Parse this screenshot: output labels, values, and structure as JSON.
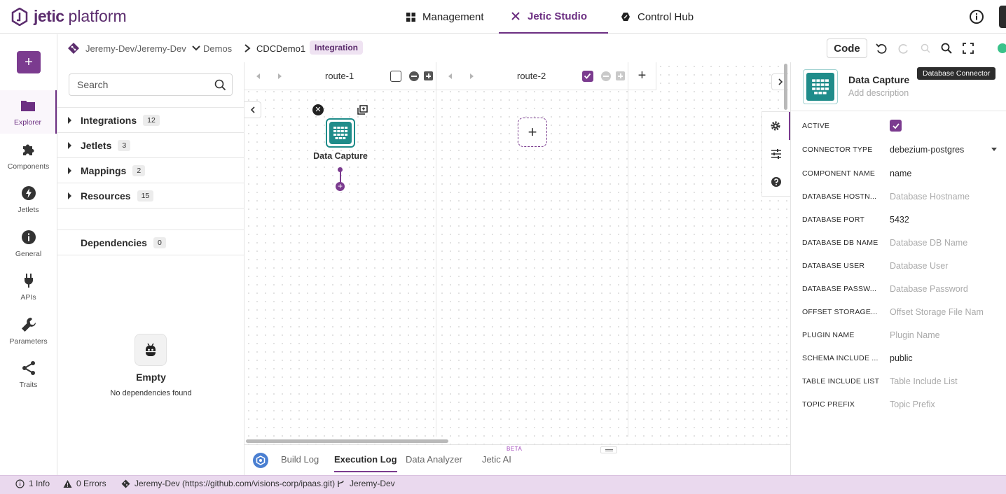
{
  "topbar": {
    "brand_a": "jetic",
    "brand_b": "platform",
    "nav": [
      {
        "label": "Management",
        "icon": "grid-icon"
      },
      {
        "label": "Jetic Studio",
        "icon": "studio-tools-icon",
        "active": true
      },
      {
        "label": "Control Hub",
        "icon": "control-hub-icon"
      }
    ]
  },
  "breadcrumb": {
    "workspace": "Jeremy-Dev/Jeremy-Dev",
    "project": "Demos",
    "item": "CDCDemo1",
    "badge": "Integration"
  },
  "toolbar": {
    "code_label": "Code"
  },
  "rail": {
    "add_label": "+",
    "items": [
      {
        "label": "Explorer",
        "icon": "folder-icon",
        "active": true
      },
      {
        "label": "Components",
        "icon": "puzzle-icon"
      },
      {
        "label": "Jetlets",
        "icon": "bolt-icon"
      },
      {
        "label": "General",
        "icon": "info-icon"
      },
      {
        "label": "APIs",
        "icon": "plug-icon"
      },
      {
        "label": "Parameters",
        "icon": "wrench-icon"
      },
      {
        "label": "Traits",
        "icon": "share-icon"
      }
    ]
  },
  "explorer": {
    "search_placeholder": "Search",
    "sections": [
      {
        "label": "Integrations",
        "count": "12"
      },
      {
        "label": "Jetlets",
        "count": "3"
      },
      {
        "label": "Mappings",
        "count": "2"
      },
      {
        "label": "Resources",
        "count": "15"
      }
    ],
    "dependencies": {
      "label": "Dependencies",
      "count": "0"
    },
    "empty_title": "Empty",
    "empty_sub": "No dependencies found"
  },
  "canvas": {
    "routes": [
      {
        "title": "route-1",
        "checked": false
      },
      {
        "title": "route-2",
        "checked": true
      }
    ],
    "add_route": "+",
    "node": {
      "label": "Data Capture",
      "close": "✕"
    },
    "route2_add": "+"
  },
  "logbar": {
    "tabs": [
      {
        "label": "Build Log"
      },
      {
        "label": "Execution Log",
        "active": true
      },
      {
        "label": "Data Analyzer"
      },
      {
        "label": "Jetic AI"
      }
    ],
    "beta": "BETA"
  },
  "props": {
    "title": "Data Capture",
    "description_placeholder": "Add description",
    "tooltip": "Database Connector",
    "rows": [
      {
        "key": "ACTIVE",
        "value": "",
        "type": "checkbox"
      },
      {
        "key": "CONNECTOR TYPE",
        "value": "debezium-postgres",
        "type": "select"
      },
      {
        "key": "COMPONENT NAME",
        "value": "name"
      },
      {
        "key": "DATABASE HOSTN...",
        "value": "Database Hostname",
        "placeholder": true
      },
      {
        "key": "DATABASE PORT",
        "value": "5432"
      },
      {
        "key": "DATABASE DB NAME",
        "value": "Database DB Name",
        "placeholder": true
      },
      {
        "key": "DATABASE USER",
        "value": "Database User",
        "placeholder": true
      },
      {
        "key": "DATABASE PASSW...",
        "value": "Database Password",
        "placeholder": true
      },
      {
        "key": "OFFSET STORAGE...",
        "value": "Offset Storage File Nam",
        "placeholder": true
      },
      {
        "key": "PLUGIN NAME",
        "value": "Plugin Name",
        "placeholder": true
      },
      {
        "key": "SCHEMA INCLUDE ...",
        "value": "public"
      },
      {
        "key": "TABLE INCLUDE LIST",
        "value": "Table Include List",
        "placeholder": true
      },
      {
        "key": "TOPIC PREFIX",
        "value": "Topic Prefix",
        "placeholder": true
      }
    ]
  },
  "statusbar": {
    "info": "1 Info",
    "errors": "0 Errors",
    "repo": "Jeremy-Dev (https://github.com/visions-corp/ipaas.git)",
    "branch": "Jeremy-Dev"
  },
  "colors": {
    "accent": "#7b3b8f",
    "brand": "#5c2d6e",
    "teal": "#1f8c8a",
    "status_bg": "#ead9ee"
  }
}
